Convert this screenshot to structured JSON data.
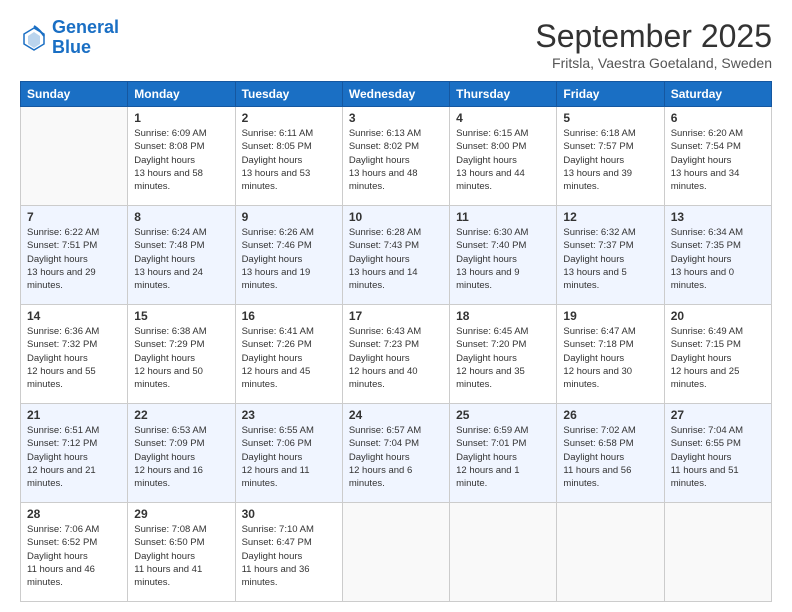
{
  "header": {
    "logo": {
      "line1": "General",
      "line2": "Blue"
    },
    "title": "September 2025",
    "location": "Fritsla, Vaestra Goetaland, Sweden"
  },
  "weekdays": [
    "Sunday",
    "Monday",
    "Tuesday",
    "Wednesday",
    "Thursday",
    "Friday",
    "Saturday"
  ],
  "weeks": [
    [
      {
        "day": "",
        "empty": true
      },
      {
        "day": "1",
        "sunrise": "6:09 AM",
        "sunset": "8:08 PM",
        "daylight": "13 hours and 58 minutes."
      },
      {
        "day": "2",
        "sunrise": "6:11 AM",
        "sunset": "8:05 PM",
        "daylight": "13 hours and 53 minutes."
      },
      {
        "day": "3",
        "sunrise": "6:13 AM",
        "sunset": "8:02 PM",
        "daylight": "13 hours and 48 minutes."
      },
      {
        "day": "4",
        "sunrise": "6:15 AM",
        "sunset": "8:00 PM",
        "daylight": "13 hours and 44 minutes."
      },
      {
        "day": "5",
        "sunrise": "6:18 AM",
        "sunset": "7:57 PM",
        "daylight": "13 hours and 39 minutes."
      },
      {
        "day": "6",
        "sunrise": "6:20 AM",
        "sunset": "7:54 PM",
        "daylight": "13 hours and 34 minutes."
      }
    ],
    [
      {
        "day": "7",
        "sunrise": "6:22 AM",
        "sunset": "7:51 PM",
        "daylight": "13 hours and 29 minutes."
      },
      {
        "day": "8",
        "sunrise": "6:24 AM",
        "sunset": "7:48 PM",
        "daylight": "13 hours and 24 minutes."
      },
      {
        "day": "9",
        "sunrise": "6:26 AM",
        "sunset": "7:46 PM",
        "daylight": "13 hours and 19 minutes."
      },
      {
        "day": "10",
        "sunrise": "6:28 AM",
        "sunset": "7:43 PM",
        "daylight": "13 hours and 14 minutes."
      },
      {
        "day": "11",
        "sunrise": "6:30 AM",
        "sunset": "7:40 PM",
        "daylight": "13 hours and 9 minutes."
      },
      {
        "day": "12",
        "sunrise": "6:32 AM",
        "sunset": "7:37 PM",
        "daylight": "13 hours and 5 minutes."
      },
      {
        "day": "13",
        "sunrise": "6:34 AM",
        "sunset": "7:35 PM",
        "daylight": "13 hours and 0 minutes."
      }
    ],
    [
      {
        "day": "14",
        "sunrise": "6:36 AM",
        "sunset": "7:32 PM",
        "daylight": "12 hours and 55 minutes."
      },
      {
        "day": "15",
        "sunrise": "6:38 AM",
        "sunset": "7:29 PM",
        "daylight": "12 hours and 50 minutes."
      },
      {
        "day": "16",
        "sunrise": "6:41 AM",
        "sunset": "7:26 PM",
        "daylight": "12 hours and 45 minutes."
      },
      {
        "day": "17",
        "sunrise": "6:43 AM",
        "sunset": "7:23 PM",
        "daylight": "12 hours and 40 minutes."
      },
      {
        "day": "18",
        "sunrise": "6:45 AM",
        "sunset": "7:20 PM",
        "daylight": "12 hours and 35 minutes."
      },
      {
        "day": "19",
        "sunrise": "6:47 AM",
        "sunset": "7:18 PM",
        "daylight": "12 hours and 30 minutes."
      },
      {
        "day": "20",
        "sunrise": "6:49 AM",
        "sunset": "7:15 PM",
        "daylight": "12 hours and 25 minutes."
      }
    ],
    [
      {
        "day": "21",
        "sunrise": "6:51 AM",
        "sunset": "7:12 PM",
        "daylight": "12 hours and 21 minutes."
      },
      {
        "day": "22",
        "sunrise": "6:53 AM",
        "sunset": "7:09 PM",
        "daylight": "12 hours and 16 minutes."
      },
      {
        "day": "23",
        "sunrise": "6:55 AM",
        "sunset": "7:06 PM",
        "daylight": "12 hours and 11 minutes."
      },
      {
        "day": "24",
        "sunrise": "6:57 AM",
        "sunset": "7:04 PM",
        "daylight": "12 hours and 6 minutes."
      },
      {
        "day": "25",
        "sunrise": "6:59 AM",
        "sunset": "7:01 PM",
        "daylight": "12 hours and 1 minute."
      },
      {
        "day": "26",
        "sunrise": "7:02 AM",
        "sunset": "6:58 PM",
        "daylight": "11 hours and 56 minutes."
      },
      {
        "day": "27",
        "sunrise": "7:04 AM",
        "sunset": "6:55 PM",
        "daylight": "11 hours and 51 minutes."
      }
    ],
    [
      {
        "day": "28",
        "sunrise": "7:06 AM",
        "sunset": "6:52 PM",
        "daylight": "11 hours and 46 minutes."
      },
      {
        "day": "29",
        "sunrise": "7:08 AM",
        "sunset": "6:50 PM",
        "daylight": "11 hours and 41 minutes."
      },
      {
        "day": "30",
        "sunrise": "7:10 AM",
        "sunset": "6:47 PM",
        "daylight": "11 hours and 36 minutes."
      },
      {
        "day": "",
        "empty": true
      },
      {
        "day": "",
        "empty": true
      },
      {
        "day": "",
        "empty": true
      },
      {
        "day": "",
        "empty": true
      }
    ]
  ]
}
